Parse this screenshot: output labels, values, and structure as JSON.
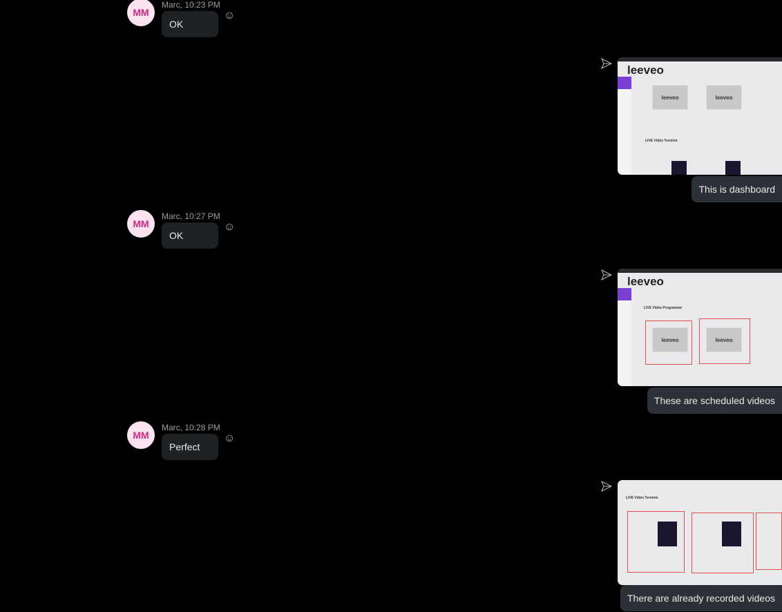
{
  "messages_in": [
    {
      "initials": "MM",
      "author_time": "Marc, 10:23 PM",
      "text": "OK"
    },
    {
      "initials": "MM",
      "author_time": "Marc, 10:27 PM",
      "text": "OK"
    },
    {
      "initials": "MM",
      "author_time": "Marc, 10:28 PM",
      "text": "Perfect"
    }
  ],
  "messages_out": [
    {
      "caption": "This is dashboard",
      "image_logo": "leeveo",
      "image_section": "LIVE Vidéo Terminé"
    },
    {
      "caption": "These are scheduled  videos",
      "image_logo": "leeveo",
      "image_section": "LIVE Vidéo Programmé"
    },
    {
      "caption": "There are already recorded videos",
      "image_section": "LIVE Vidéo Terminé"
    }
  ],
  "icons": {
    "reaction": "smiley-icon",
    "sent": "send-icon"
  }
}
